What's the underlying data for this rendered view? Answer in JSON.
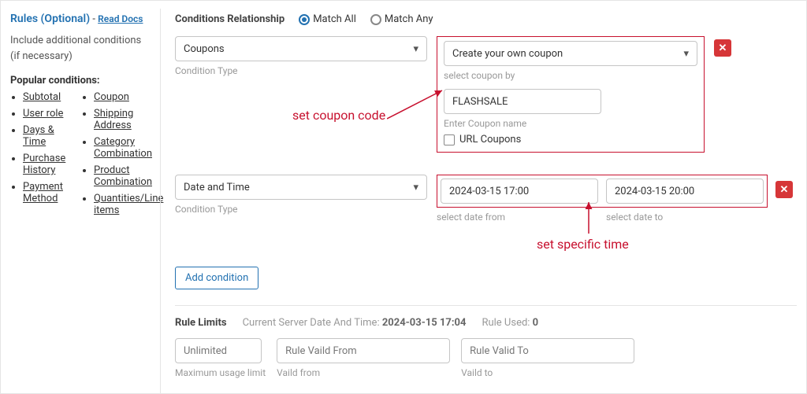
{
  "sidebar": {
    "title": "Rules (Optional)",
    "dash": " - ",
    "read_docs": "Read Docs",
    "desc": "Include additional conditions (if necessary)",
    "popular_label": "Popular conditions:",
    "col1": [
      "Subtotal",
      "User role",
      "Days & Time",
      "Purchase History",
      "Payment Method"
    ],
    "col2": [
      "Coupon",
      "Shipping Address",
      "Category Combination",
      "Product Combination",
      "Quantities/Line items"
    ]
  },
  "relationship": {
    "label": "Conditions Relationship",
    "match_all": "Match All",
    "match_any": "Match Any",
    "selected": "all"
  },
  "conditions": [
    {
      "type_value": "Coupons",
      "type_hint": "Condition Type",
      "method_value": "Create your own coupon",
      "method_hint": "select coupon by",
      "coupon_value": "FLASHSALE",
      "coupon_hint": "Enter Coupon name",
      "url_coupons_label": "URL Coupons"
    },
    {
      "type_value": "Date and Time",
      "type_hint": "Condition Type",
      "from_value": "2024-03-15 17:00",
      "from_hint": "select date from",
      "to_value": "2024-03-15 20:00",
      "to_hint": "select date to"
    }
  ],
  "add_condition_label": "Add condition",
  "limits": {
    "title": "Rule Limits",
    "server_prefix": "Current Server Date And Time: ",
    "server_value": "2024-03-15 17:04",
    "used_prefix": "Rule Used: ",
    "used_value": "0",
    "usage_placeholder": "Unlimited",
    "usage_hint": "Maximum usage limit",
    "from_placeholder": "Rule Vaild From",
    "from_hint": "Vaild from",
    "to_placeholder": "Rule Valid To",
    "to_hint": "Vaild to"
  },
  "annotations": {
    "a1": "set coupon code",
    "a2": "set specific time"
  },
  "icons": {
    "chev": "▾",
    "x": "✕"
  }
}
